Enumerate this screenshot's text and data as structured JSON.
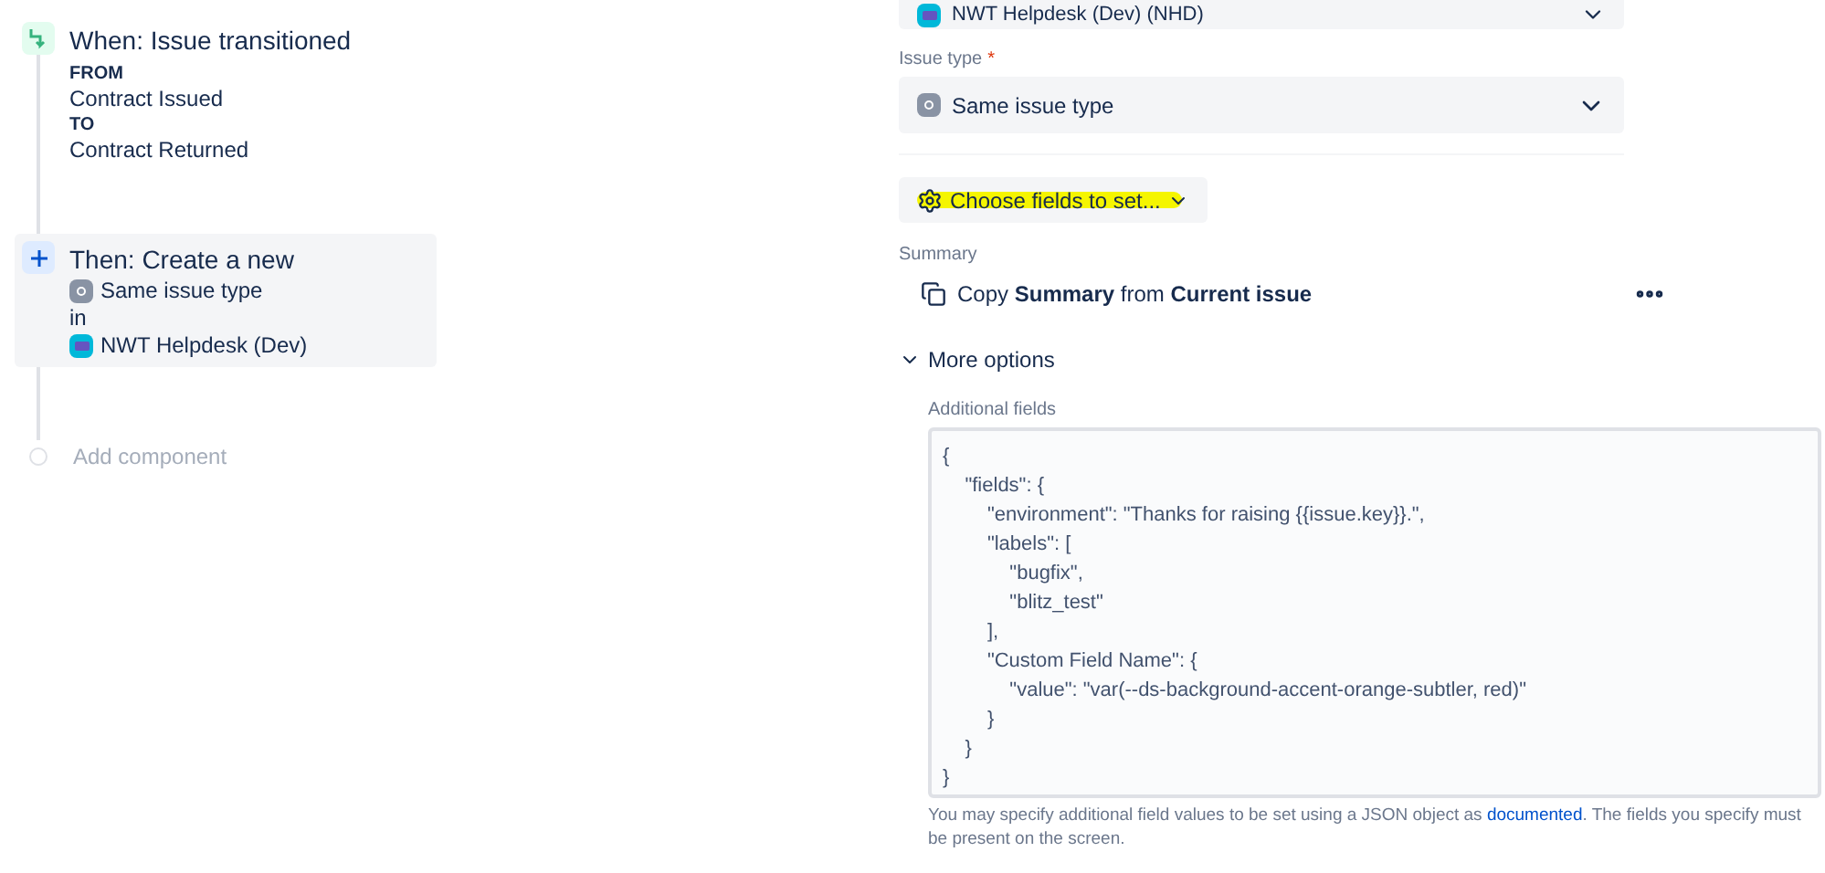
{
  "timeline": {
    "trigger": {
      "title": "When: Issue transitioned",
      "from_label": "FROM",
      "from_value": "Contract Issued",
      "to_label": "TO",
      "to_value": "Contract Returned"
    },
    "action": {
      "title": "Then: Create a new",
      "issue_type": "Same issue type",
      "connector": "in",
      "project": "NWT Helpdesk (Dev)"
    },
    "add_component": "Add component"
  },
  "form": {
    "project_select": {
      "value": "NWT Helpdesk (Dev) (NHD)"
    },
    "issue_type": {
      "label": "Issue type",
      "required_mark": "*",
      "value": "Same issue type"
    },
    "choose_fields": {
      "label": "Choose fields to set...",
      "highlighted": true
    },
    "summary": {
      "label": "Summary",
      "value": "Copy **Summary** from **Current issue**"
    },
    "more_options": {
      "label": "More options",
      "expanded": true
    },
    "additional_fields": {
      "label": "Additional fields",
      "value": "{\n    \"fields\": {\n        \"environment\": \"Thanks for raising {{issue.key}}.\",\n        \"labels\": [\n            \"bugfix\",\n            \"blitz_test\"\n        ],\n        \"Custom Field Name\": {\n            \"value\": \"var(--ds-background-accent-orange-subtler, red)\"\n        }\n    }\n}",
      "help_before": "You may specify additional field values to be set using a JSON object as",
      "help_link": "documented",
      "help_after": ". The fields you specify must be present on the screen."
    }
  }
}
